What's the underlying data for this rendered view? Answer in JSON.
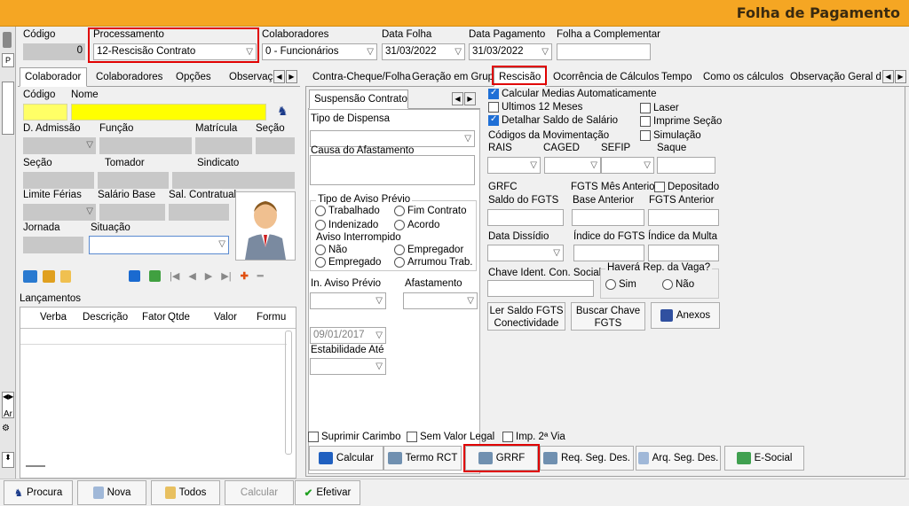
{
  "window": {
    "title": "Folha de Pagamento"
  },
  "header": {
    "codigo_label": "Código",
    "codigo_value": "0",
    "processamento_label": "Processamento",
    "processamento_value": "12-Rescisão Contrato",
    "colaboradores_label": "Colaboradores",
    "colaboradores_value": "0 - Funcionários",
    "data_folha_label": "Data Folha",
    "data_folha_value": "31/03/2022",
    "data_pagamento_label": "Data Pagamento",
    "data_pagamento_value": "31/03/2022",
    "folha_complementar_label": "Folha a Complementar"
  },
  "left_tabs": [
    "Colaborador",
    "Colaboradores",
    "Opções",
    "Observaç"
  ],
  "left": {
    "codigo_label": "Código",
    "nome_label": "Nome",
    "d_admissao_label": "D. Admissão",
    "funcao_label": "Função",
    "matricula_label": "Matrícula",
    "secao_label": "Seção",
    "secao2_label": "Seção",
    "tomador_label": "Tomador",
    "sindicato_label": "Sindicato",
    "limite_ferias_label": "Limite Férias",
    "salario_base_label": "Salário Base",
    "sal_contratual_label": "Sal. Contratual",
    "jornada_label": "Jornada",
    "situacao_label": "Situação",
    "lancamentos_label": "Lançamentos",
    "grid_columns": [
      "Verba",
      "Descrição",
      "Fator",
      "Qtde",
      "Valor",
      "Formu"
    ]
  },
  "right_tabs": [
    "Contra-Cheque/Folha",
    "Geração em Grupo",
    "Rescisão",
    "Ocorrência de Cálculos",
    "Tempo",
    "Como os cálculos",
    "Observação Geral da"
  ],
  "rescisao": {
    "sub_tab": "Suspensão Contrato",
    "tipo_dispensa_label": "Tipo de Dispensa",
    "causa_afastamento_label": "Causa do Afastamento",
    "tipo_aviso_label": "Tipo de Aviso Prévio",
    "aviso_opts": [
      "Trabalhado",
      "Fim Contrato",
      "Indenizado",
      "Acordo"
    ],
    "aviso_interrompido_label": "Aviso Interrompido",
    "interrompido_opts": [
      "Não",
      "Empregador",
      "Empregado",
      "Arrumou Trab."
    ],
    "in_aviso_label": "In. Aviso  Prévio",
    "afastamento_label": "Afastamento",
    "date_value": "09/01/2017",
    "estabilidade_label": "Estabilidade Até",
    "calc_medias": "Calcular Medias Automaticamente",
    "ultimos12": "Ultimos 12  Meses",
    "laser": "Laser",
    "detalhar_fgts": "Detalhar Saldo de Salário",
    "imprime_secao": "Imprime Seção",
    "codigos_mov": "Códigos da Movimentação",
    "simulacao": "Simulação",
    "rais": "RAIS",
    "caged": "CAGED",
    "sefip": "SEFIP",
    "saque": "Saque",
    "grfc": "GRFC",
    "fgts_mes_anterior": "FGTS Mês Anterior",
    "depositado": "Depositado",
    "saldo_fgts": "Saldo do FGTS",
    "base_anterior": "Base Anterior",
    "fgts_anterior": "FGTS Anterior",
    "data_dissidio": "Data Dissídio",
    "indice_fgts": "Índice do FGTS",
    "indice_multa": "Índice da Multa",
    "chave_ident": "Chave Ident. Con. Social",
    "havera_rep": "Haverá Rep. da Vaga?",
    "sim": "Sim",
    "nao": "Não",
    "ler_saldo": "Ler Saldo FGTS Conectividade",
    "buscar_chave": "Buscar Chave FGTS",
    "anexos": "Anexos",
    "suprimir": "Suprimir Carimbo",
    "sem_valor": "Sem Valor Legal",
    "imp2via": "Imp. 2ª Via"
  },
  "action_buttons": [
    "Calcular",
    "Termo RCT",
    "GRRF",
    "Req. Seg. Des.",
    "Arq. Seg. Des.",
    "E-Social"
  ],
  "bottom_buttons": [
    "Procura",
    "Nova",
    "Todos",
    "Calcular",
    "Efetivar"
  ],
  "sidebar_letters": [
    "Ar"
  ],
  "colors": {
    "title_bar": "#f5a623",
    "highlight": "#e00000",
    "yellow_field": "#ffff66"
  }
}
